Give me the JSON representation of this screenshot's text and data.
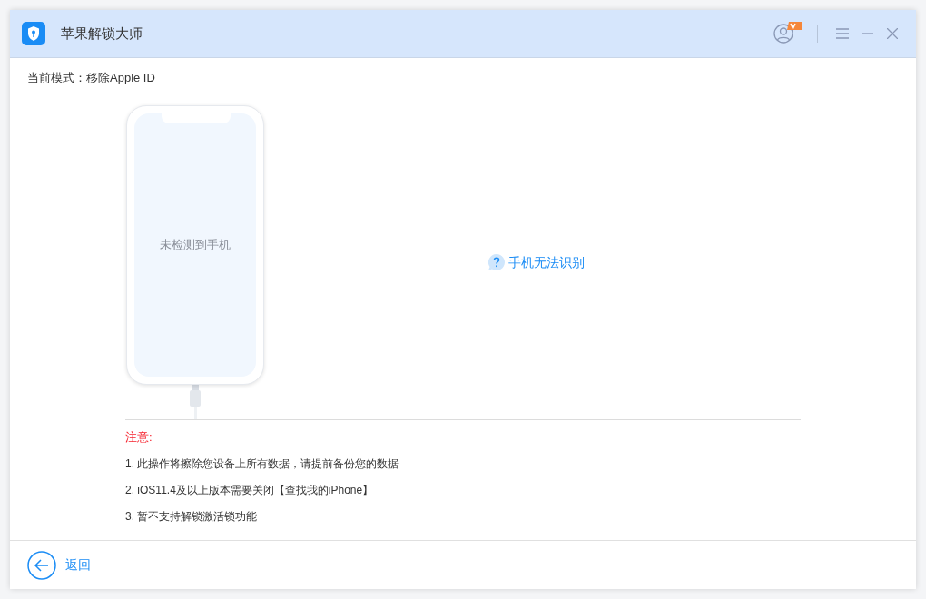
{
  "window": {
    "title": "苹果解锁大师"
  },
  "mode": {
    "label": "当前模式：移除Apple ID"
  },
  "phone": {
    "status": "未检测到手机"
  },
  "help_link": "手机无法识别",
  "notes": {
    "title": "注意:",
    "items": [
      "1. 此操作将擦除您设备上所有数据，请提前备份您的数据",
      "2. iOS11.4及以上版本需要关闭【查找我的iPhone】",
      "3. 暂不支持解锁激活锁功能"
    ]
  },
  "footer": {
    "back": "返回"
  }
}
